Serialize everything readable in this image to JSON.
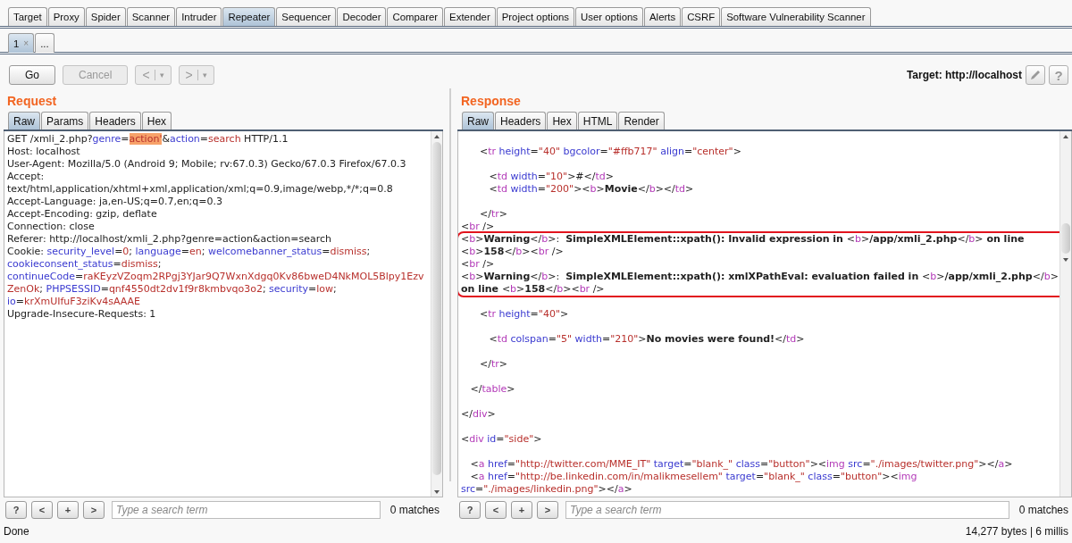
{
  "main_tabs": [
    {
      "label": "Target",
      "selected": false
    },
    {
      "label": "Proxy",
      "selected": false
    },
    {
      "label": "Spider",
      "selected": false
    },
    {
      "label": "Scanner",
      "selected": false
    },
    {
      "label": "Intruder",
      "selected": false
    },
    {
      "label": "Repeater",
      "selected": true
    },
    {
      "label": "Sequencer",
      "selected": false
    },
    {
      "label": "Decoder",
      "selected": false
    },
    {
      "label": "Comparer",
      "selected": false
    },
    {
      "label": "Extender",
      "selected": false
    },
    {
      "label": "Project options",
      "selected": false
    },
    {
      "label": "User options",
      "selected": false
    },
    {
      "label": "Alerts",
      "selected": false
    },
    {
      "label": "CSRF",
      "selected": false
    },
    {
      "label": "Software Vulnerability Scanner",
      "selected": false
    }
  ],
  "sub_tabs": [
    {
      "label": "1",
      "close": "×",
      "selected": true
    },
    {
      "label": "...",
      "selected": false
    }
  ],
  "toolbar": {
    "buttons": [
      {
        "label": "Go",
        "disabled": false
      },
      {
        "label": "Cancel",
        "disabled": true
      },
      {
        "label": "<",
        "menu": "▾",
        "disabled": true
      },
      {
        "label": ">",
        "menu": "▾",
        "disabled": true
      }
    ],
    "target": "Target: http://localhost",
    "help": "?"
  },
  "panes": [
    {
      "title": "Request",
      "tabs": [
        {
          "label": "Raw",
          "selected": true
        },
        {
          "label": "Params",
          "selected": false
        },
        {
          "label": "Headers",
          "selected": false
        },
        {
          "label": "Hex",
          "selected": false
        }
      ],
      "lines": [
        {
          "segments": [
            {
              "kind": "plain",
              "text": "GET /xmli_2.php?"
            },
            {
              "kind": "name",
              "text": "genre"
            },
            {
              "kind": "plain",
              "text": "="
            },
            {
              "kind": "mark",
              "text": "action'"
            },
            {
              "kind": "plain",
              "text": "&"
            },
            {
              "kind": "name",
              "text": "action"
            },
            {
              "kind": "plain",
              "text": "="
            },
            {
              "kind": "value",
              "text": "search"
            },
            {
              "kind": "plain",
              "text": " HTTP/1.1"
            }
          ]
        },
        {
          "segments": [
            {
              "kind": "plain",
              "text": "Host: localhost"
            }
          ]
        },
        {
          "segments": [
            {
              "kind": "plain",
              "text": "User-Agent: Mozilla/5.0 (Android 9; Mobile; rv:67.0.3) Gecko/67.0.3 Firefox/67.0.3"
            }
          ]
        },
        {
          "segments": [
            {
              "kind": "plain",
              "text": "Accept:"
            }
          ]
        },
        {
          "segments": [
            {
              "kind": "plain",
              "text": "text/html,application/xhtml+xml,application/xml;q=0.9,image/webp,*/*;q=0.8"
            }
          ]
        },
        {
          "segments": [
            {
              "kind": "plain",
              "text": "Accept-Language: ja,en-US;q=0.7,en;q=0.3"
            }
          ]
        },
        {
          "segments": [
            {
              "kind": "plain",
              "text": "Accept-Encoding: gzip, deflate"
            }
          ]
        },
        {
          "segments": [
            {
              "kind": "plain",
              "text": "Connection: close"
            }
          ]
        },
        {
          "segments": [
            {
              "kind": "plain",
              "text": "Referer: http://localhost/xmli_2.php?genre=action&action=search"
            }
          ]
        },
        {
          "segments": [
            {
              "kind": "plain",
              "text": "Cookie: "
            },
            {
              "kind": "name",
              "text": "security_level"
            },
            {
              "kind": "plain",
              "text": "="
            },
            {
              "kind": "value",
              "text": "0"
            },
            {
              "kind": "plain",
              "text": "; "
            },
            {
              "kind": "name",
              "text": "language"
            },
            {
              "kind": "plain",
              "text": "="
            },
            {
              "kind": "value",
              "text": "en"
            },
            {
              "kind": "plain",
              "text": "; "
            },
            {
              "kind": "name",
              "text": "welcomebanner_status"
            },
            {
              "kind": "plain",
              "text": "="
            },
            {
              "kind": "value",
              "text": "dismiss"
            },
            {
              "kind": "plain",
              "text": ";"
            }
          ]
        },
        {
          "segments": [
            {
              "kind": "name",
              "text": "cookieconsent_status"
            },
            {
              "kind": "plain",
              "text": "="
            },
            {
              "kind": "value",
              "text": "dismiss"
            },
            {
              "kind": "plain",
              "text": ";"
            }
          ]
        },
        {
          "segments": [
            {
              "kind": "name",
              "text": "continueCode"
            },
            {
              "kind": "plain",
              "text": "="
            },
            {
              "kind": "value",
              "text": "raKEyzVZoqm2RPgj3YJar9Q7WxnXdgq0Kv86bweD4NkMOL5Blpy1Ezv"
            }
          ]
        },
        {
          "segments": [
            {
              "kind": "value",
              "text": "ZenOk"
            },
            {
              "kind": "plain",
              "text": "; "
            },
            {
              "kind": "name",
              "text": "PHPSESSID"
            },
            {
              "kind": "plain",
              "text": "="
            },
            {
              "kind": "value",
              "text": "qnf4550dt2dv1f9r8kmbvqo3o2"
            },
            {
              "kind": "plain",
              "text": "; "
            },
            {
              "kind": "name",
              "text": "security"
            },
            {
              "kind": "plain",
              "text": "="
            },
            {
              "kind": "value",
              "text": "low"
            },
            {
              "kind": "plain",
              "text": ";"
            }
          ]
        },
        {
          "segments": [
            {
              "kind": "name",
              "text": "io"
            },
            {
              "kind": "plain",
              "text": "="
            },
            {
              "kind": "value",
              "text": "krXmUIfuF3ziKv4sAAAE"
            }
          ]
        },
        {
          "segments": [
            {
              "kind": "plain",
              "text": "Upgrade-Insecure-Requests: 1"
            }
          ]
        }
      ],
      "search": {
        "buttons": [
          {
            "label": "?"
          },
          {
            "label": "<"
          },
          {
            "label": "+"
          },
          {
            "label": ">"
          }
        ],
        "placeholder": "Type a search term",
        "matches": "0 matches"
      }
    },
    {
      "title": "Response",
      "tabs": [
        {
          "label": "Raw",
          "selected": true
        },
        {
          "label": "Headers",
          "selected": false
        },
        {
          "label": "Hex",
          "selected": false
        },
        {
          "label": "HTML",
          "selected": false
        },
        {
          "label": "Render",
          "selected": false
        }
      ],
      "lines": [
        {
          "kind": "blank"
        },
        {
          "kind": "code",
          "boxed": false,
          "segments": [
            {
              "kind": "plain",
              "text": "      <"
            },
            {
              "kind": "tag",
              "text": "tr"
            },
            {
              "kind": "name",
              "text": " height"
            },
            {
              "kind": "plain",
              "text": "="
            },
            {
              "kind": "value",
              "text": "\"40\""
            },
            {
              "kind": "name",
              "text": " bgcolor"
            },
            {
              "kind": "plain",
              "text": "="
            },
            {
              "kind": "value",
              "text": "\"#ffb717\""
            },
            {
              "kind": "name",
              "text": " align"
            },
            {
              "kind": "plain",
              "text": "="
            },
            {
              "kind": "value",
              "text": "\"center\""
            },
            {
              "kind": "plain",
              "text": ">"
            }
          ]
        },
        {
          "kind": "blank"
        },
        {
          "kind": "code",
          "boxed": false,
          "segments": [
            {
              "kind": "plain",
              "text": "         <"
            },
            {
              "kind": "tag",
              "text": "td"
            },
            {
              "kind": "name",
              "text": " width"
            },
            {
              "kind": "plain",
              "text": "="
            },
            {
              "kind": "value",
              "text": "\"10\""
            },
            {
              "kind": "plain",
              "text": ">#</"
            },
            {
              "kind": "tag",
              "text": "td"
            },
            {
              "kind": "plain",
              "text": ">"
            }
          ]
        },
        {
          "kind": "code",
          "boxed": false,
          "segments": [
            {
              "kind": "plain",
              "text": "         <"
            },
            {
              "kind": "tag",
              "text": "td"
            },
            {
              "kind": "name",
              "text": " width"
            },
            {
              "kind": "plain",
              "text": "="
            },
            {
              "kind": "value",
              "text": "\"200\""
            },
            {
              "kind": "plain",
              "text": "><"
            },
            {
              "kind": "tag",
              "text": "b"
            },
            {
              "kind": "plain",
              "text": ">"
            },
            {
              "kind": "bold",
              "text": "Movie"
            },
            {
              "kind": "plain",
              "text": "</"
            },
            {
              "kind": "tag",
              "text": "b"
            },
            {
              "kind": "plain",
              "text": "></"
            },
            {
              "kind": "tag",
              "text": "td"
            },
            {
              "kind": "plain",
              "text": ">"
            }
          ]
        },
        {
          "kind": "blank"
        },
        {
          "kind": "code",
          "boxed": false,
          "segments": [
            {
              "kind": "plain",
              "text": "      </"
            },
            {
              "kind": "tag",
              "text": "tr"
            },
            {
              "kind": "plain",
              "text": ">"
            }
          ]
        },
        {
          "kind": "code",
          "boxed": false,
          "segments": [
            {
              "kind": "plain",
              "text": "<"
            },
            {
              "kind": "tag",
              "text": "br"
            },
            {
              "kind": "plain",
              "text": " />"
            }
          ]
        },
        {
          "kind": "code",
          "boxed": true,
          "segments": [
            {
              "kind": "plain",
              "text": "<"
            },
            {
              "kind": "tag",
              "text": "b"
            },
            {
              "kind": "plain",
              "text": ">"
            },
            {
              "kind": "bold",
              "text": "Warning"
            },
            {
              "kind": "plain",
              "text": "</"
            },
            {
              "kind": "tag",
              "text": "b"
            },
            {
              "kind": "plain",
              "text": ">:  "
            },
            {
              "kind": "bold",
              "text": "SimpleXMLElement::xpath(): Invalid expression in "
            },
            {
              "kind": "plain",
              "text": "<"
            },
            {
              "kind": "tag",
              "text": "b"
            },
            {
              "kind": "plain",
              "text": ">"
            },
            {
              "kind": "bold",
              "text": "/app/xmli_2.php"
            },
            {
              "kind": "plain",
              "text": "</"
            },
            {
              "kind": "tag",
              "text": "b"
            },
            {
              "kind": "plain",
              "text": ">"
            },
            {
              "kind": "bold",
              "text": " on line"
            }
          ]
        },
        {
          "kind": "code",
          "boxed": true,
          "segments": [
            {
              "kind": "plain",
              "text": "<"
            },
            {
              "kind": "tag",
              "text": "b"
            },
            {
              "kind": "plain",
              "text": ">"
            },
            {
              "kind": "bold",
              "text": "158"
            },
            {
              "kind": "plain",
              "text": "</"
            },
            {
              "kind": "tag",
              "text": "b"
            },
            {
              "kind": "plain",
              "text": "><"
            },
            {
              "kind": "tag",
              "text": "br"
            },
            {
              "kind": "plain",
              "text": " />"
            }
          ]
        },
        {
          "kind": "code",
          "boxed": true,
          "segments": [
            {
              "kind": "plain",
              "text": "<"
            },
            {
              "kind": "tag",
              "text": "br"
            },
            {
              "kind": "plain",
              "text": " />"
            }
          ]
        },
        {
          "kind": "code",
          "boxed": true,
          "segments": [
            {
              "kind": "plain",
              "text": "<"
            },
            {
              "kind": "tag",
              "text": "b"
            },
            {
              "kind": "plain",
              "text": ">"
            },
            {
              "kind": "bold",
              "text": "Warning"
            },
            {
              "kind": "plain",
              "text": "</"
            },
            {
              "kind": "tag",
              "text": "b"
            },
            {
              "kind": "plain",
              "text": ">:  "
            },
            {
              "kind": "bold",
              "text": "SimpleXMLElement::xpath(): xmlXPathEval: evaluation failed in "
            },
            {
              "kind": "plain",
              "text": "<"
            },
            {
              "kind": "tag",
              "text": "b"
            },
            {
              "kind": "plain",
              "text": ">"
            },
            {
              "kind": "bold",
              "text": "/app/xmli_2.php"
            },
            {
              "kind": "plain",
              "text": "</"
            },
            {
              "kind": "tag",
              "text": "b"
            },
            {
              "kind": "plain",
              "text": ">"
            }
          ]
        },
        {
          "kind": "code",
          "boxed": true,
          "segments": [
            {
              "kind": "bold",
              "text": "on line "
            },
            {
              "kind": "plain",
              "text": "<"
            },
            {
              "kind": "tag",
              "text": "b"
            },
            {
              "kind": "plain",
              "text": ">"
            },
            {
              "kind": "bold",
              "text": "158"
            },
            {
              "kind": "plain",
              "text": "</"
            },
            {
              "kind": "tag",
              "text": "b"
            },
            {
              "kind": "plain",
              "text": "><"
            },
            {
              "kind": "tag",
              "text": "br"
            },
            {
              "kind": "plain",
              "text": " />"
            }
          ]
        },
        {
          "kind": "blank"
        },
        {
          "kind": "code",
          "boxed": false,
          "segments": [
            {
              "kind": "plain",
              "text": "      <"
            },
            {
              "kind": "tag",
              "text": "tr"
            },
            {
              "kind": "name",
              "text": " height"
            },
            {
              "kind": "plain",
              "text": "="
            },
            {
              "kind": "value",
              "text": "\"40\""
            },
            {
              "kind": "plain",
              "text": ">"
            }
          ]
        },
        {
          "kind": "blank"
        },
        {
          "kind": "code",
          "boxed": false,
          "segments": [
            {
              "kind": "plain",
              "text": "         <"
            },
            {
              "kind": "tag",
              "text": "td"
            },
            {
              "kind": "name",
              "text": " colspan"
            },
            {
              "kind": "plain",
              "text": "="
            },
            {
              "kind": "value",
              "text": "\"5\""
            },
            {
              "kind": "name",
              "text": " width"
            },
            {
              "kind": "plain",
              "text": "="
            },
            {
              "kind": "value",
              "text": "\"210\""
            },
            {
              "kind": "plain",
              "text": ">"
            },
            {
              "kind": "bold",
              "text": "No movies were found!"
            },
            {
              "kind": "plain",
              "text": "</"
            },
            {
              "kind": "tag",
              "text": "td"
            },
            {
              "kind": "plain",
              "text": ">"
            }
          ]
        },
        {
          "kind": "blank"
        },
        {
          "kind": "code",
          "boxed": false,
          "segments": [
            {
              "kind": "plain",
              "text": "      </"
            },
            {
              "kind": "tag",
              "text": "tr"
            },
            {
              "kind": "plain",
              "text": ">"
            }
          ]
        },
        {
          "kind": "blank"
        },
        {
          "kind": "code",
          "boxed": false,
          "segments": [
            {
              "kind": "plain",
              "text": "   </"
            },
            {
              "kind": "tag",
              "text": "table"
            },
            {
              "kind": "plain",
              "text": ">"
            }
          ]
        },
        {
          "kind": "blank"
        },
        {
          "kind": "code",
          "boxed": false,
          "segments": [
            {
              "kind": "plain",
              "text": "</"
            },
            {
              "kind": "tag",
              "text": "div"
            },
            {
              "kind": "plain",
              "text": ">"
            }
          ]
        },
        {
          "kind": "blank"
        },
        {
          "kind": "code",
          "boxed": false,
          "segments": [
            {
              "kind": "plain",
              "text": "<"
            },
            {
              "kind": "tag",
              "text": "div"
            },
            {
              "kind": "name",
              "text": " id"
            },
            {
              "kind": "plain",
              "text": "="
            },
            {
              "kind": "value",
              "text": "\"side\""
            },
            {
              "kind": "plain",
              "text": ">"
            }
          ]
        },
        {
          "kind": "blank"
        },
        {
          "kind": "code",
          "boxed": false,
          "segments": [
            {
              "kind": "plain",
              "text": "   <"
            },
            {
              "kind": "tag",
              "text": "a"
            },
            {
              "kind": "name",
              "text": " href"
            },
            {
              "kind": "plain",
              "text": "="
            },
            {
              "kind": "value",
              "text": "\"http://twitter.com/MME_IT\""
            },
            {
              "kind": "name",
              "text": " target"
            },
            {
              "kind": "plain",
              "text": "="
            },
            {
              "kind": "value",
              "text": "\"blank_\""
            },
            {
              "kind": "name",
              "text": " class"
            },
            {
              "kind": "plain",
              "text": "="
            },
            {
              "kind": "value",
              "text": "\"button\""
            },
            {
              "kind": "plain",
              "text": "><"
            },
            {
              "kind": "tag",
              "text": "img"
            },
            {
              "kind": "name",
              "text": " src"
            },
            {
              "kind": "plain",
              "text": "="
            },
            {
              "kind": "value",
              "text": "\"./images/twitter.png\""
            },
            {
              "kind": "plain",
              "text": "></"
            },
            {
              "kind": "tag",
              "text": "a"
            },
            {
              "kind": "plain",
              "text": ">"
            }
          ]
        },
        {
          "kind": "code",
          "boxed": false,
          "segments": [
            {
              "kind": "plain",
              "text": "   <"
            },
            {
              "kind": "tag",
              "text": "a"
            },
            {
              "kind": "name",
              "text": " href"
            },
            {
              "kind": "plain",
              "text": "="
            },
            {
              "kind": "value",
              "text": "\"http://be.linkedin.com/in/malikmesellem\""
            },
            {
              "kind": "name",
              "text": " target"
            },
            {
              "kind": "plain",
              "text": "="
            },
            {
              "kind": "value",
              "text": "\"blank_\""
            },
            {
              "kind": "name",
              "text": " class"
            },
            {
              "kind": "plain",
              "text": "="
            },
            {
              "kind": "value",
              "text": "\"button\""
            },
            {
              "kind": "plain",
              "text": "><"
            },
            {
              "kind": "tag",
              "text": "img"
            }
          ]
        },
        {
          "kind": "code",
          "boxed": false,
          "segments": [
            {
              "kind": "name",
              "text": "src"
            },
            {
              "kind": "plain",
              "text": "="
            },
            {
              "kind": "value",
              "text": "\"./images/linkedin.png\""
            },
            {
              "kind": "plain",
              "text": "></"
            },
            {
              "kind": "tag",
              "text": "a"
            },
            {
              "kind": "plain",
              "text": ">"
            }
          ]
        }
      ],
      "search": {
        "buttons": [
          {
            "label": "?"
          },
          {
            "label": "<"
          },
          {
            "label": "+"
          },
          {
            "label": ">"
          }
        ],
        "placeholder": "Type a search term",
        "matches": "0 matches"
      }
    }
  ],
  "status_bar": {
    "left": "Done",
    "right": "14,277 bytes | 6 millis"
  }
}
